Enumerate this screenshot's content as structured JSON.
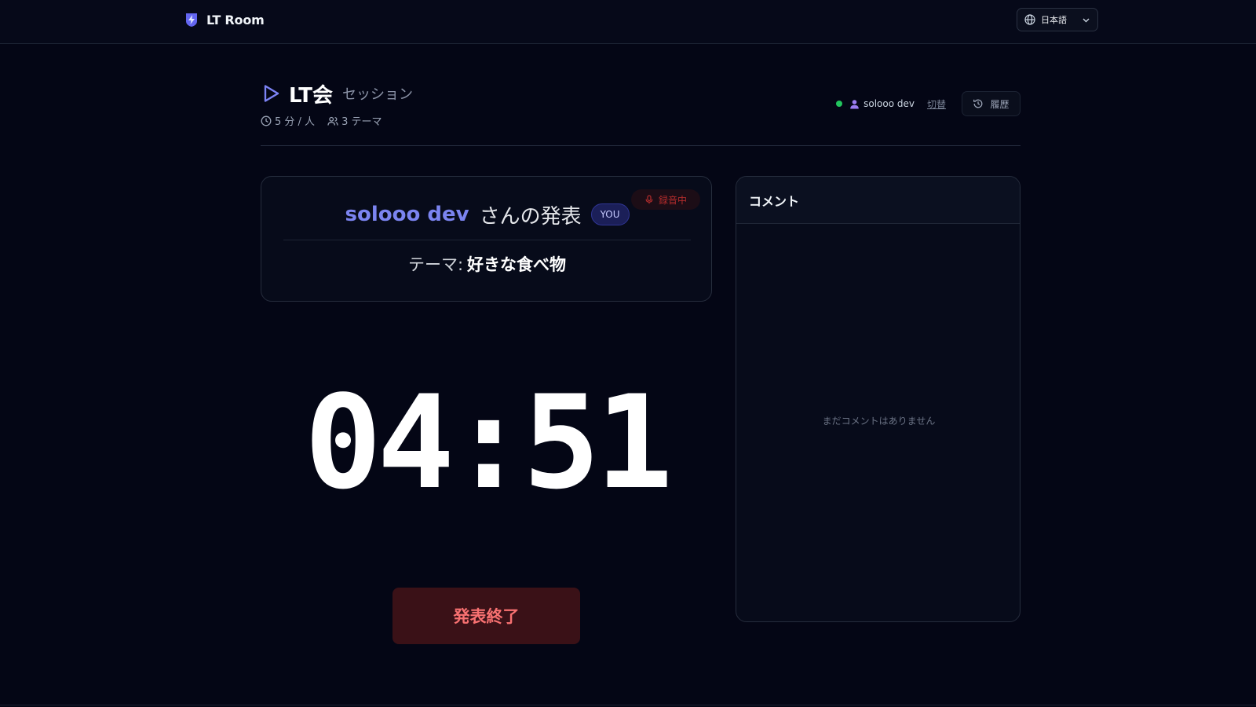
{
  "app": {
    "brand_name": "LT Room",
    "brand_icon": "lightning-shield-icon",
    "accent_color": "#7b84f0"
  },
  "language_select": {
    "selected": "日本語",
    "icon": "globe-icon"
  },
  "session": {
    "title": "LT会",
    "subtitle": "セッション",
    "time_per_person": "5 分 / 人",
    "theme_count": "3 テーマ"
  },
  "user": {
    "status": "online",
    "name": "solooo dev",
    "switch_label": "切替",
    "history_label": "履歴"
  },
  "presentation": {
    "presenter_name": "solooo dev",
    "presenter_suffix": "さんの発表",
    "you_badge": "YOU",
    "recording_label": "録音中",
    "theme_prefix": "テーマ:",
    "theme_value": "好きな食べ物"
  },
  "timer": {
    "display": "04:51"
  },
  "actions": {
    "end_presentation": "発表終了"
  },
  "comments": {
    "title": "コメント",
    "empty_message": "まだコメントはありません"
  }
}
